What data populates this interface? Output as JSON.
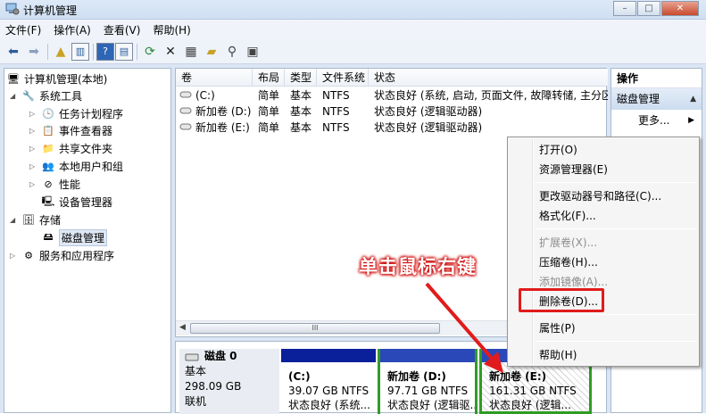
{
  "window": {
    "title": "计算机管理",
    "min": "–",
    "max": "□",
    "close": "✕"
  },
  "menu": [
    "文件(F)",
    "操作(A)",
    "查看(V)",
    "帮助(H)"
  ],
  "tree": {
    "root": "计算机管理(本地)",
    "system_tools": "系统工具",
    "task_scheduler": "任务计划程序",
    "event_viewer": "事件查看器",
    "shared_folders": "共享文件夹",
    "local_users": "本地用户和组",
    "performance": "性能",
    "device_manager": "设备管理器",
    "storage": "存储",
    "disk_management": "磁盘管理",
    "services": "服务和应用程序"
  },
  "volumes": {
    "headers": [
      "卷",
      "布局",
      "类型",
      "文件系统",
      "状态"
    ],
    "rows": [
      {
        "name": "(C:)",
        "layout": "简单",
        "type": "基本",
        "fs": "NTFS",
        "status": "状态良好 (系统, 启动, 页面文件, 故障转储, 主分区)"
      },
      {
        "name": "新加卷 (D:)",
        "layout": "简单",
        "type": "基本",
        "fs": "NTFS",
        "status": "状态良好 (逻辑驱动器)"
      },
      {
        "name": "新加卷 (E:)",
        "layout": "简单",
        "type": "基本",
        "fs": "NTFS",
        "status": "状态良好 (逻辑驱动器)"
      }
    ],
    "scroll_grip": "III"
  },
  "disk": {
    "name": "磁盘 0",
    "type": "基本",
    "size": "298.09 GB",
    "status": "联机",
    "partitions": [
      {
        "label": "(C:)",
        "size": "39.07 GB NTFS",
        "status": "状态良好 (系统..."
      },
      {
        "label": "新加卷 (D:)",
        "size": "97.71 GB NTFS",
        "status": "状态良好 (逻辑驱..."
      },
      {
        "label": "新加卷 (E:)",
        "size": "161.31 GB NTFS",
        "status": "状态良好 (逻辑..."
      }
    ]
  },
  "actions": {
    "header": "操作",
    "section": "磁盘管理",
    "more": "更多..."
  },
  "context_menu": {
    "open": "打开(O)",
    "explore": "资源管理器(E)",
    "change_letter": "更改驱动器号和路径(C)...",
    "format": "格式化(F)...",
    "extend": "扩展卷(X)...",
    "shrink": "压缩卷(H)...",
    "mirror": "添加镜像(A)...",
    "delete": "删除卷(D)...",
    "properties": "属性(P)",
    "help": "帮助(H)"
  },
  "annotation": {
    "text": "单击鼠标右键",
    "color": "#e11b1b"
  }
}
